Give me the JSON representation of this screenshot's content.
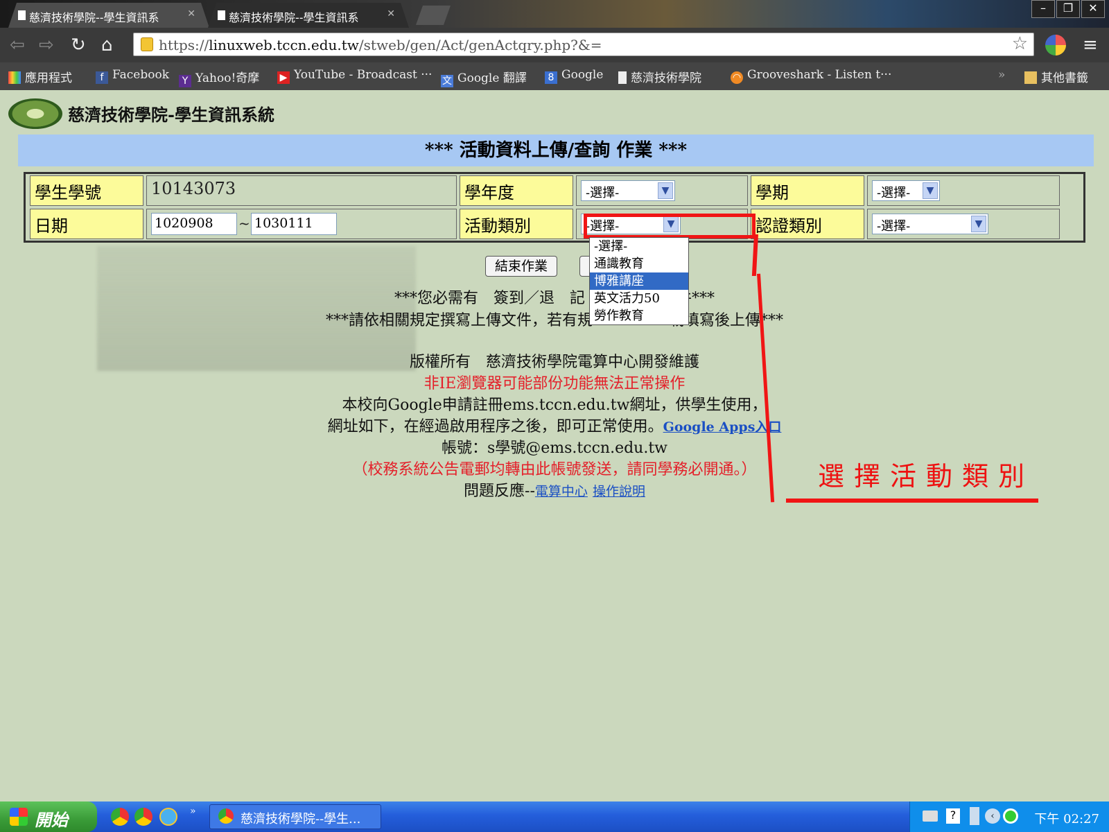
{
  "browser": {
    "tabs": [
      {
        "title": "慈濟技術學院--學生資訊系"
      },
      {
        "title": "慈濟技術學院--學生資訊系"
      }
    ],
    "url_prefix": "https://",
    "url_host": "linuxweb.tccn.edu.tw",
    "url_path": "/stweb/gen/Act/genActqry.php?&=",
    "bookmarks": [
      {
        "label": "應用程式",
        "icon": "apps-grid-icon"
      },
      {
        "label": "Facebook",
        "icon": "facebook-icon"
      },
      {
        "label": "Yahoo!奇摩",
        "icon": "yahoo-icon"
      },
      {
        "label": "YouTube - Broadcast ···",
        "icon": "youtube-icon"
      },
      {
        "label": "Google 翻譯",
        "icon": "google-translate-icon"
      },
      {
        "label": "Google",
        "icon": "google-icon"
      },
      {
        "label": "慈濟技術學院",
        "icon": "page-icon"
      },
      {
        "label": "Grooveshark - Listen t···",
        "icon": "grooveshark-icon"
      },
      {
        "label": "»",
        "icon": ""
      },
      {
        "label": "其他書籤",
        "icon": "folder-icon"
      }
    ]
  },
  "page": {
    "site_title": "慈濟技術學院-學生資訊系統",
    "banner": "*** 活動資料上傳/查詢 作業 ***",
    "form": {
      "student_id_label": "學生學號",
      "student_id_value": "10143073",
      "year_label": "學年度",
      "year_value": "-選擇-",
      "semester_label": "學期",
      "semester_value": "-選擇-",
      "date_label": "日期",
      "date_from": "1020908",
      "date_sep": "~",
      "date_to": "1030111",
      "category_label": "活動類別",
      "category_value": "-選擇-",
      "cert_label": "認證類別",
      "cert_value": "-選擇-"
    },
    "category_options": [
      "-選擇-",
      "通識教育",
      "博雅講座",
      "英文活力50",
      "勞作教育"
    ],
    "category_highlighted": "博雅講座",
    "buttons": {
      "end": "結束作業"
    },
    "notice1": "***您必需有　簽到／退　記",
    "notice1_tail": "文件***",
    "notice2": "***請依相關規定撰寫上傳文件，若有規",
    "notice2_tail": "載填寫後上傳***",
    "copyright": "版權所有　慈濟技術學院電算中心開發維護",
    "warning": "非IE瀏覽器可能部份功能無法正常操作",
    "google_line1": "本校向Google申請註冊ems.tccn.edu.tw網址，供學生使用，",
    "google_line2": "網址如下，在經過啟用程序之後，即可正常使用。",
    "google_link": "Google Apps入口",
    "account": "帳號：s學號@ems.tccn.edu.tw",
    "account_note": "（校務系統公告電郵均轉由此帳號發送，請同學務必開通。）",
    "feedback_prefix": "問題反應--",
    "feedback_link1": "電算中心",
    "feedback_link2": "操作說明"
  },
  "annotation": {
    "text": "選擇活動類別",
    "color": "#f01515"
  },
  "taskbar": {
    "start": "開始",
    "window": "慈濟技術學院--學生...",
    "clock": "下午 02:27"
  }
}
